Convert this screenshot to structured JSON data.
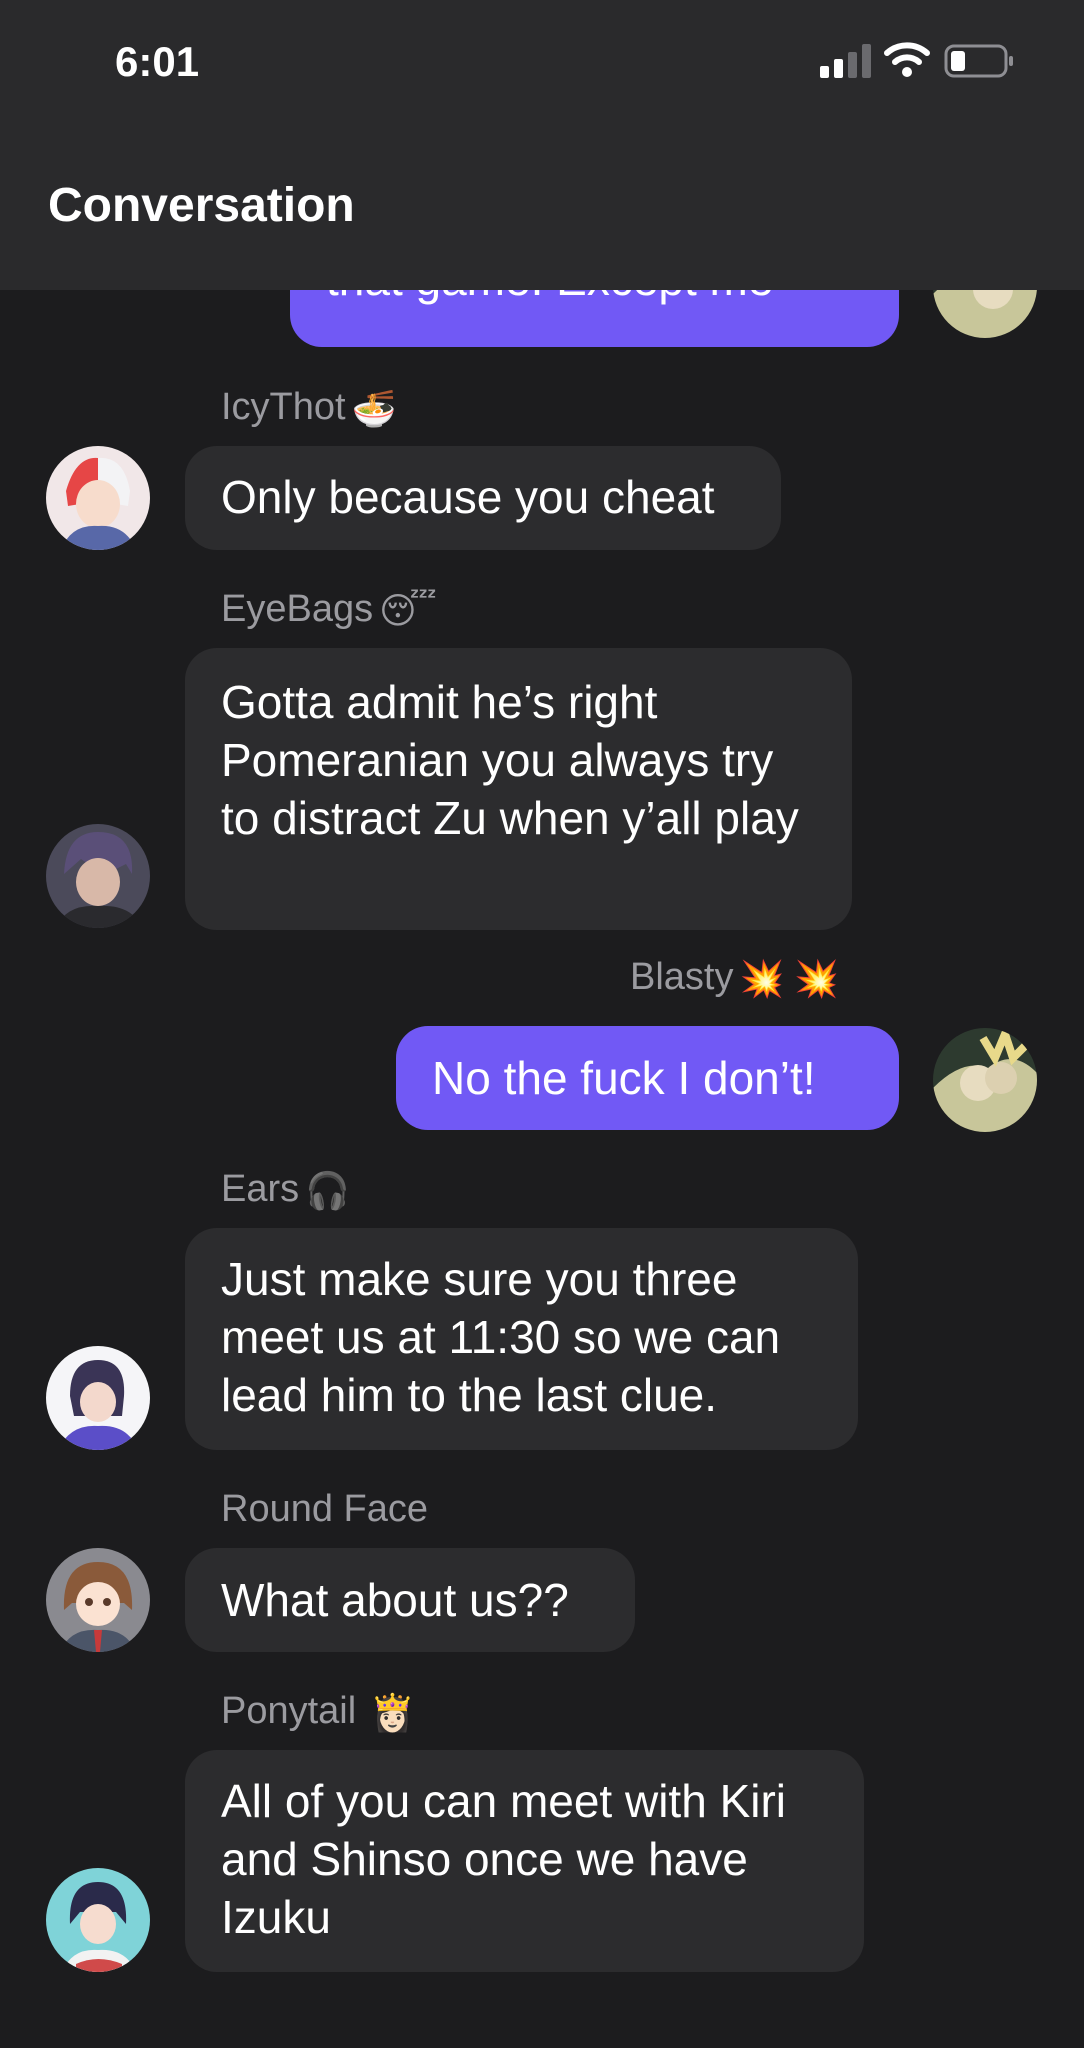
{
  "status_bar": {
    "time": "6:01"
  },
  "header": {
    "title": "Conversation"
  },
  "messages": [
    {
      "text": "that game. Except me",
      "direction": "out"
    },
    {
      "sender": "IcyThot",
      "emoji": "🍜",
      "text": "Only because you cheat",
      "direction": "in"
    },
    {
      "sender": "EyeBags",
      "emoji": "😴",
      "text": "Gotta admit he’s right Pomeranian you always try to distract Zu when y’all play",
      "direction": "in"
    },
    {
      "sender": "Blasty",
      "emoji": "💥 💥",
      "text": "No the fuck I don’t!",
      "direction": "out"
    },
    {
      "sender": "Ears",
      "emoji": "🎧",
      "text": "Just make sure you three meet us at 11:30 so we can lead him to the last clue.",
      "direction": "in"
    },
    {
      "sender": "Round Face",
      "text": "What about us??",
      "direction": "in"
    },
    {
      "sender": "Ponytail",
      "emoji": "👸🏻",
      "text": "All of you can meet with Kiri and Shinso once we have Izuku",
      "direction": "in"
    }
  ],
  "colors": {
    "background": "#1c1c1e",
    "bar": "#2a2a2c",
    "incoming_bubble": "#2c2c2e",
    "outgoing_bubble": "#7159f5",
    "sender_name": "#9b9ba0"
  }
}
